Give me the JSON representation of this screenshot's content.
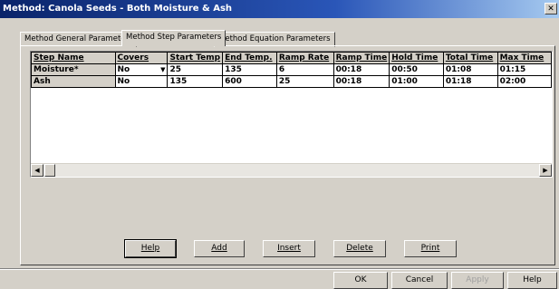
{
  "window": {
    "title": "Method: Canola Seeds - Both Moisture & Ash"
  },
  "tabs": [
    {
      "label": "Method General Parameters"
    },
    {
      "label": "Method Step Parameters"
    },
    {
      "label": "Method Equation Parameters"
    }
  ],
  "grid": {
    "columns": [
      "Step Name",
      "Covers",
      "Start Temp",
      "End Temp.",
      "Ramp Rate",
      "Ramp Time",
      "Hold Time",
      "Total Time",
      "Max Time"
    ],
    "rows": [
      [
        "Moisture*",
        "No",
        "25",
        "135",
        "6",
        "00:18",
        "00:50",
        "01:08",
        "01:15"
      ],
      [
        "Ash",
        "No",
        "135",
        "600",
        "25",
        "00:18",
        "01:00",
        "01:18",
        "02:00"
      ]
    ]
  },
  "step_buttons": {
    "help": "Help",
    "add": "Add",
    "insert": "Insert",
    "delete": "Delete",
    "print": "Print"
  },
  "dialog_buttons": {
    "ok": "OK",
    "cancel": "Cancel",
    "apply": "Apply",
    "help": "Help"
  }
}
